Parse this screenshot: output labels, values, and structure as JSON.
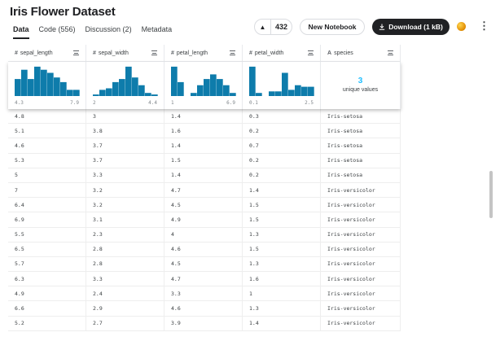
{
  "page_title": "Iris Flower Dataset",
  "tabs": [
    {
      "label": "Data",
      "active": true
    },
    {
      "label": "Code (556)",
      "active": false
    },
    {
      "label": "Discussion (2)",
      "active": false
    },
    {
      "label": "Metadata",
      "active": false
    }
  ],
  "vote": {
    "icon": "caret-up-icon",
    "count": "432"
  },
  "actions": {
    "new_notebook": "New Notebook",
    "download": "Download (1 kB)",
    "download_icon": "download-icon"
  },
  "colors": {
    "accent": "#20beff",
    "bar": "#0e7cab",
    "dark_button": "#202124"
  },
  "columns": [
    {
      "type_icon": "#",
      "name": "sepal_length",
      "kind": "numeric",
      "min": "4.3",
      "max": "7.9",
      "histogram": [
        0.55,
        0.85,
        0.55,
        0.95,
        0.85,
        0.75,
        0.6,
        0.45,
        0.2,
        0.2
      ]
    },
    {
      "type_icon": "#",
      "name": "sepal_width",
      "kind": "numeric",
      "min": "2",
      "max": "4.4",
      "histogram": [
        0.05,
        0.2,
        0.25,
        0.45,
        0.55,
        0.95,
        0.6,
        0.35,
        0.1,
        0.05
      ]
    },
    {
      "type_icon": "#",
      "name": "petal_length",
      "kind": "numeric",
      "min": "1",
      "max": "6.9",
      "histogram": [
        0.95,
        0.45,
        0.0,
        0.1,
        0.35,
        0.55,
        0.7,
        0.55,
        0.35,
        0.1
      ]
    },
    {
      "type_icon": "#",
      "name": "petal_width",
      "kind": "numeric",
      "min": "0.1",
      "max": "2.5",
      "histogram": [
        0.95,
        0.1,
        0.0,
        0.15,
        0.15,
        0.75,
        0.2,
        0.35,
        0.3,
        0.3
      ]
    },
    {
      "type_icon": "A",
      "name": "species",
      "kind": "categorical",
      "unique_count": "3",
      "unique_label": "unique values"
    }
  ],
  "rows": [
    [
      "4.8",
      "3",
      "1.4",
      "0.3",
      "Iris-setosa"
    ],
    [
      "5.1",
      "3.8",
      "1.6",
      "0.2",
      "Iris-setosa"
    ],
    [
      "4.6",
      "3.7",
      "1.4",
      "0.7",
      "Iris-setosa"
    ],
    [
      "5.3",
      "3.7",
      "1.5",
      "0.2",
      "Iris-setosa"
    ],
    [
      "5",
      "3.3",
      "1.4",
      "0.2",
      "Iris-setosa"
    ],
    [
      "7",
      "3.2",
      "4.7",
      "1.4",
      "Iris-versicolor"
    ],
    [
      "6.4",
      "3.2",
      "4.5",
      "1.5",
      "Iris-versicolor"
    ],
    [
      "6.9",
      "3.1",
      "4.9",
      "1.5",
      "Iris-versicolor"
    ],
    [
      "5.5",
      "2.3",
      "4",
      "1.3",
      "Iris-versicolor"
    ],
    [
      "6.5",
      "2.8",
      "4.6",
      "1.5",
      "Iris-versicolor"
    ],
    [
      "5.7",
      "2.8",
      "4.5",
      "1.3",
      "Iris-versicolor"
    ],
    [
      "6.3",
      "3.3",
      "4.7",
      "1.6",
      "Iris-versicolor"
    ],
    [
      "4.9",
      "2.4",
      "3.3",
      "1",
      "Iris-versicolor"
    ],
    [
      "6.6",
      "2.9",
      "4.6",
      "1.3",
      "Iris-versicolor"
    ],
    [
      "5.2",
      "2.7",
      "3.9",
      "1.4",
      "Iris-versicolor"
    ]
  ]
}
